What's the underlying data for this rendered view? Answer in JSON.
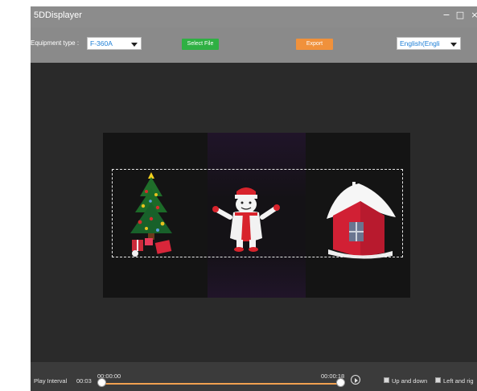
{
  "window": {
    "title": "5DDisplayer",
    "minimize_glyph": "−",
    "maximize_glyph": "□",
    "close_glyph": "×"
  },
  "toolbar": {
    "equipment_label": "Equipment type :",
    "equipment_value": "F-360A",
    "select_file_label": "Select File",
    "export_label": "Export",
    "language_value": "English(Engli",
    "colors": {
      "select_file": "#2fb043",
      "export": "#f0913b"
    }
  },
  "preview": {
    "items": [
      "christmas-tree",
      "snowman",
      "house"
    ]
  },
  "footer": {
    "play_interval_label": "Play Interval",
    "play_interval_value": "00:03",
    "time_start": "00:00:00",
    "time_end": "00:00:18",
    "option_up_down": "Up and down",
    "option_left_right": "Left and rig",
    "accent_color": "#f0a050"
  }
}
